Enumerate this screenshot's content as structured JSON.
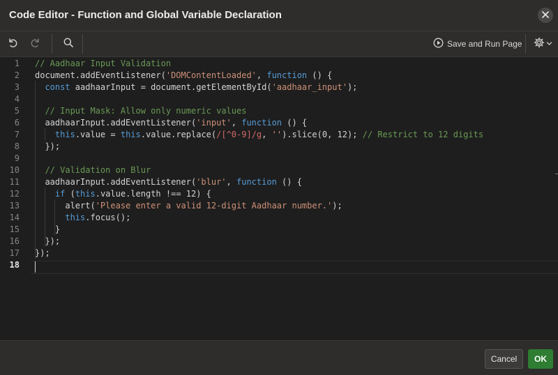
{
  "dialog": {
    "title": "Code Editor - Function and Global Variable Declaration"
  },
  "toolbar": {
    "save_run_label": "Save and Run Page",
    "icons": [
      "undo-icon",
      "redo-icon",
      "search-icon",
      "play-circle-icon",
      "gear-icon",
      "chevron-down-icon"
    ]
  },
  "editor": {
    "active_line": 18,
    "line_numbers": [
      "1",
      "2",
      "3",
      "4",
      "5",
      "6",
      "7",
      "8",
      "9",
      "10",
      "11",
      "12",
      "13",
      "14",
      "15",
      "16",
      "17",
      "18"
    ],
    "lines": [
      [
        [
          "c-cmt",
          "// Aadhaar Input Validation"
        ]
      ],
      [
        [
          "",
          "document.addEventListener("
        ],
        [
          "c-str",
          "'DOMContentLoaded'"
        ],
        [
          "",
          ", "
        ],
        [
          "c-kw",
          "function"
        ],
        [
          "",
          " () {"
        ]
      ],
      [
        [
          "",
          "  "
        ],
        [
          "c-kw",
          "const"
        ],
        [
          "",
          " aadhaarInput = document.getElementById("
        ],
        [
          "c-str",
          "'aadhaar_input'"
        ],
        [
          "",
          ");"
        ]
      ],
      [
        [
          "",
          ""
        ]
      ],
      [
        [
          "",
          "  "
        ],
        [
          "c-cmt",
          "// Input Mask: Allow only numeric values"
        ]
      ],
      [
        [
          "",
          "  aadhaarInput.addEventListener("
        ],
        [
          "c-str",
          "'input'"
        ],
        [
          "",
          ", "
        ],
        [
          "c-kw",
          "function"
        ],
        [
          "",
          " () {"
        ]
      ],
      [
        [
          "",
          "    "
        ],
        [
          "c-kw",
          "this"
        ],
        [
          "",
          ".value = "
        ],
        [
          "c-kw",
          "this"
        ],
        [
          "",
          ".value.replace("
        ],
        [
          "c-rx",
          "/[^0-9]/g"
        ],
        [
          "",
          ", "
        ],
        [
          "c-str",
          "''"
        ],
        [
          "",
          ").slice(0, 12); "
        ],
        [
          "c-cmt",
          "// Restrict to 12 digits"
        ]
      ],
      [
        [
          "",
          "  });"
        ]
      ],
      [
        [
          "",
          ""
        ]
      ],
      [
        [
          "",
          "  "
        ],
        [
          "c-cmt",
          "// Validation on Blur"
        ]
      ],
      [
        [
          "",
          "  aadhaarInput.addEventListener("
        ],
        [
          "c-str",
          "'blur'"
        ],
        [
          "",
          ", "
        ],
        [
          "c-kw",
          "function"
        ],
        [
          "",
          " () {"
        ]
      ],
      [
        [
          "",
          "    "
        ],
        [
          "c-kw",
          "if"
        ],
        [
          "",
          " ("
        ],
        [
          "c-kw",
          "this"
        ],
        [
          "",
          ".value.length !== 12) {"
        ]
      ],
      [
        [
          "",
          "      alert("
        ],
        [
          "c-str",
          "'Please enter a valid 12-digit Aadhaar number.'"
        ],
        [
          "",
          ");"
        ]
      ],
      [
        [
          "",
          "      "
        ],
        [
          "c-kw",
          "this"
        ],
        [
          "",
          ".focus();"
        ]
      ],
      [
        [
          "",
          "    }"
        ]
      ],
      [
        [
          "",
          "  });"
        ]
      ],
      [
        [
          "",
          "});"
        ]
      ],
      [
        [
          "",
          ""
        ]
      ]
    ]
  },
  "footer": {
    "cancel_label": "Cancel",
    "ok_label": "OK"
  },
  "colors": {
    "ok_button": "#2e7d32",
    "comment": "#6a9955",
    "keyword": "#569cd6",
    "string": "#ce9178"
  }
}
